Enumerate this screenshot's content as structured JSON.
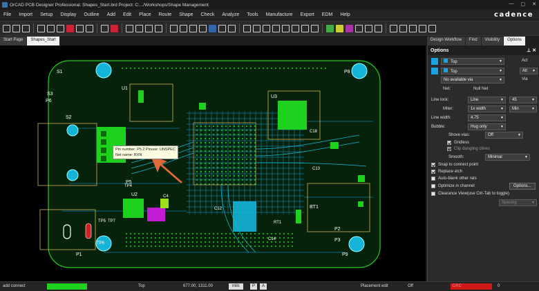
{
  "window": {
    "title": "OrCAD PCB Designer Professional: Shapes_Start.brd  Project: C:.../Workshops/Shape Management",
    "controls": [
      "—",
      "▢",
      "✕"
    ]
  },
  "menu": [
    "File",
    "Import",
    "Setup",
    "Display",
    "Outline",
    "Add",
    "Edit",
    "Place",
    "Route",
    "Shape",
    "Check",
    "Analyze",
    "Tools",
    "Manufacture",
    "Export",
    "EDM",
    "Help"
  ],
  "brand": "cadence",
  "left_tabs": [
    "Start Page",
    "Shapes_Start"
  ],
  "right_tabs": [
    "Design Workflow",
    "Find",
    "Visibility",
    "Options"
  ],
  "board": {
    "labels": [
      "S1",
      "S2",
      "P6",
      "P5",
      "P8",
      "U1",
      "U2",
      "U3",
      "P1",
      "P9",
      "P2",
      "P3",
      "TP6",
      "TP7",
      "TP5",
      "TP4",
      "C12",
      "C14",
      "BT1",
      "RT1",
      "C18",
      "C13",
      "C4",
      "S3"
    ],
    "colors": {
      "board": "#0a3b0a",
      "copper": "#1fd11f",
      "pad": "#9be01b",
      "via": "#14b5d9",
      "outline": "#bfa24a",
      "highlight": "#c21bd4"
    }
  },
  "tooltip": {
    "line1": "Pin number: P5.2   Pinuse: UNSPEC",
    "line2": "Net name: RXN"
  },
  "options": {
    "title": "Options",
    "pin_icon": "pin-icon",
    "close_icon": "close-icon",
    "act_label": "Act",
    "alt_label": "Alt",
    "via_label": "Via",
    "act_layer": "Top",
    "alt_layer": "Top",
    "act_value": "Top",
    "alt_value": "Alt",
    "via_select": "No available via",
    "net_label": "Net:",
    "net_value": "Null Net",
    "line_lock_label": "Line lock:",
    "line_lock_value": "Line",
    "line_lock_angle": "45",
    "miter_label": "Miter:",
    "miter_value": "1x width",
    "miter_min": "Min",
    "line_width_label": "Line width:",
    "line_width_value": "4.75",
    "bubble_label": "Bubble:",
    "bubble_value": "Hug only",
    "shove_vias_label": "Shove vias:",
    "shove_vias_value": "Off",
    "gridless": "Gridless",
    "clip_dangling": "Clip dangling clines",
    "smooth_label": "Smooth:",
    "smooth_value": "Minimal",
    "snap": "Snap to connect point",
    "replace_etch": "Replace etch",
    "auto_blank": "Auto-blank other rats",
    "optimize": "Optimize in channel",
    "options_button": "Options...",
    "clearance": "Clearance View(use Ctrl-Tab to toggle)",
    "spacing_value": "Spacing"
  },
  "status": {
    "command": "add connect",
    "layer": "Top",
    "coords": "677.00, 1311.00",
    "units": "mils",
    "p_button": "P",
    "a_button": "A",
    "mode": "Placement edit",
    "off": "Off",
    "drc": "DRC",
    "count": "0"
  }
}
